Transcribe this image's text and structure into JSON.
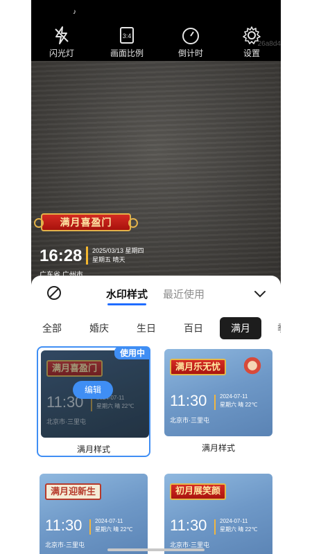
{
  "status": {
    "app_icon": "tiktok-icon"
  },
  "toolbar": {
    "items": [
      {
        "label": "闪光灯",
        "icon": "flash-off-icon"
      },
      {
        "label": "画面比例",
        "icon": "aspect-ratio-icon"
      },
      {
        "label": "倒计时",
        "icon": "timer-icon"
      },
      {
        "label": "设置",
        "icon": "gear-icon"
      }
    ],
    "watermark_id": "26a8d4"
  },
  "preview": {
    "banner_text": "满月喜盈门",
    "time": "16:28",
    "date_line1": "2025/03/13 星期四",
    "date_line2": "星期五  晴天",
    "location": "广东省 广州市"
  },
  "sheet": {
    "tabs": [
      {
        "label": "水印样式",
        "active": true
      },
      {
        "label": "最近使用",
        "active": false
      }
    ],
    "categories": [
      "全部",
      "婚庆",
      "生日",
      "百日",
      "满月",
      "季"
    ],
    "active_category": "满月",
    "cards": [
      {
        "title": "满月样式",
        "banner": "满月喜盈门",
        "badge": "使用中",
        "edit_label": "编辑",
        "time": "11:30",
        "date1": "2024-07-11",
        "date2": "星期六 晴 22℃",
        "location": "北京市·三里屯",
        "selected": true
      },
      {
        "title": "满月样式",
        "banner": "满月乐无忧",
        "time": "11:30",
        "date1": "2024-07-11",
        "date2": "星期六 晴 22℃",
        "location": "北京市·三里屯"
      },
      {
        "title": "",
        "banner": "满月迎新生",
        "time": "11:30",
        "date1": "2024-07-11",
        "date2": "星期六 晴 22℃",
        "location": "北京市·三里屯"
      },
      {
        "title": "",
        "banner": "初月展笑颜",
        "time": "11:30",
        "date1": "2024-07-11",
        "date2": "星期六 晴 22℃",
        "location": "北京市·三里屯"
      }
    ]
  },
  "colors": {
    "accent": "#3f8ef4",
    "tab_underline": "#1f6cff",
    "banner_red": "#c81f18",
    "banner_gold": "#e3b24a"
  }
}
